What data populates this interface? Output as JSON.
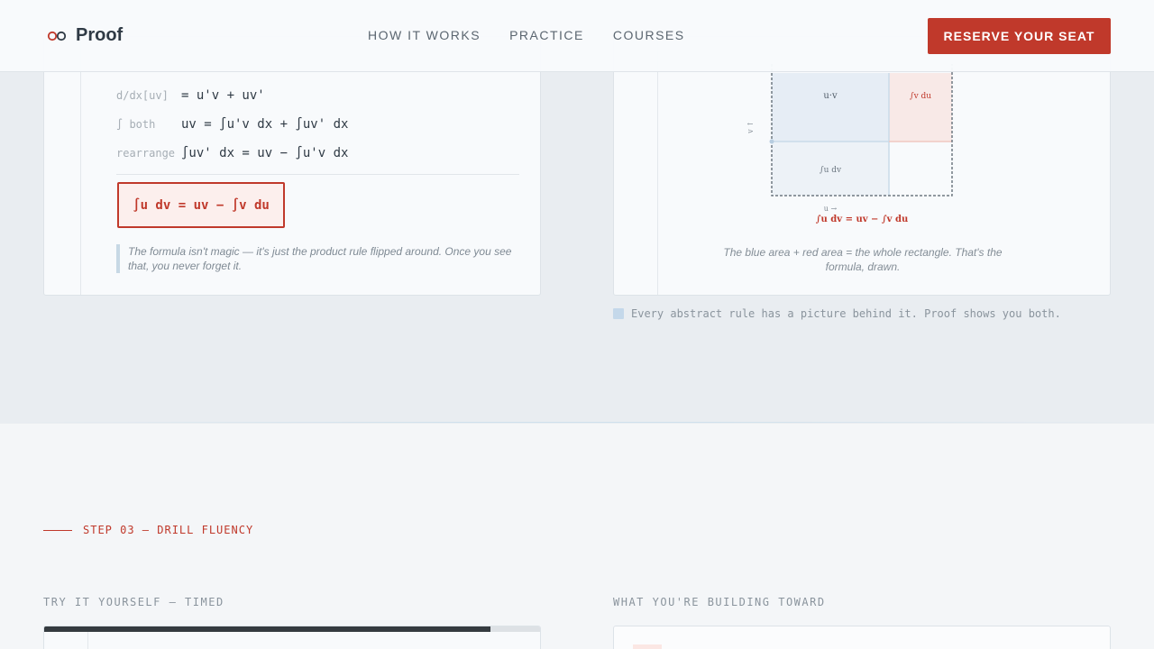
{
  "header": {
    "brand": "Proof",
    "nav": [
      "HOW IT WORKS",
      "PRACTICE",
      "COURSES"
    ],
    "cta": "RESERVE YOUR SEAT"
  },
  "derivation": {
    "rows": [
      {
        "label": "d/dx[uv]",
        "body": "= u'v + uv'"
      },
      {
        "label": "∫ both",
        "body": "uv = ∫u'v dx + ∫uv' dx"
      },
      {
        "label": "rearrange",
        "body": "∫uv' dx = uv − ∫u'v dx"
      }
    ],
    "result": "∫u dv = uv − ∫v du",
    "quote": "The formula isn't magic — it's just the product rule flipped around. Once you see that, you never forget it."
  },
  "diagram": {
    "labels": {
      "uv": "u·v",
      "vdu": "∫v du",
      "udv": "∫u dv",
      "v_axis": "v ↑",
      "u_axis": "u →",
      "formula": "∫u dv = uv − ∫v du"
    },
    "caption": "The blue area + red area = the whole rectangle. That's the formula, drawn.",
    "tagline": "Every abstract rule has a picture behind it. Proof shows you both.",
    "colors": {
      "blue": "#c4d8ea",
      "red": "#c0392b"
    }
  },
  "step": {
    "label": "STEP 03 — DRILL FLUENCY",
    "left_heading": "TRY IT YOURSELF — TIMED",
    "right_heading": "WHAT YOU'RE BUILDING TOWARD",
    "timer_progress": 0.9
  },
  "colors": {
    "accent": "#c0392b",
    "ink": "#2f3a45"
  }
}
